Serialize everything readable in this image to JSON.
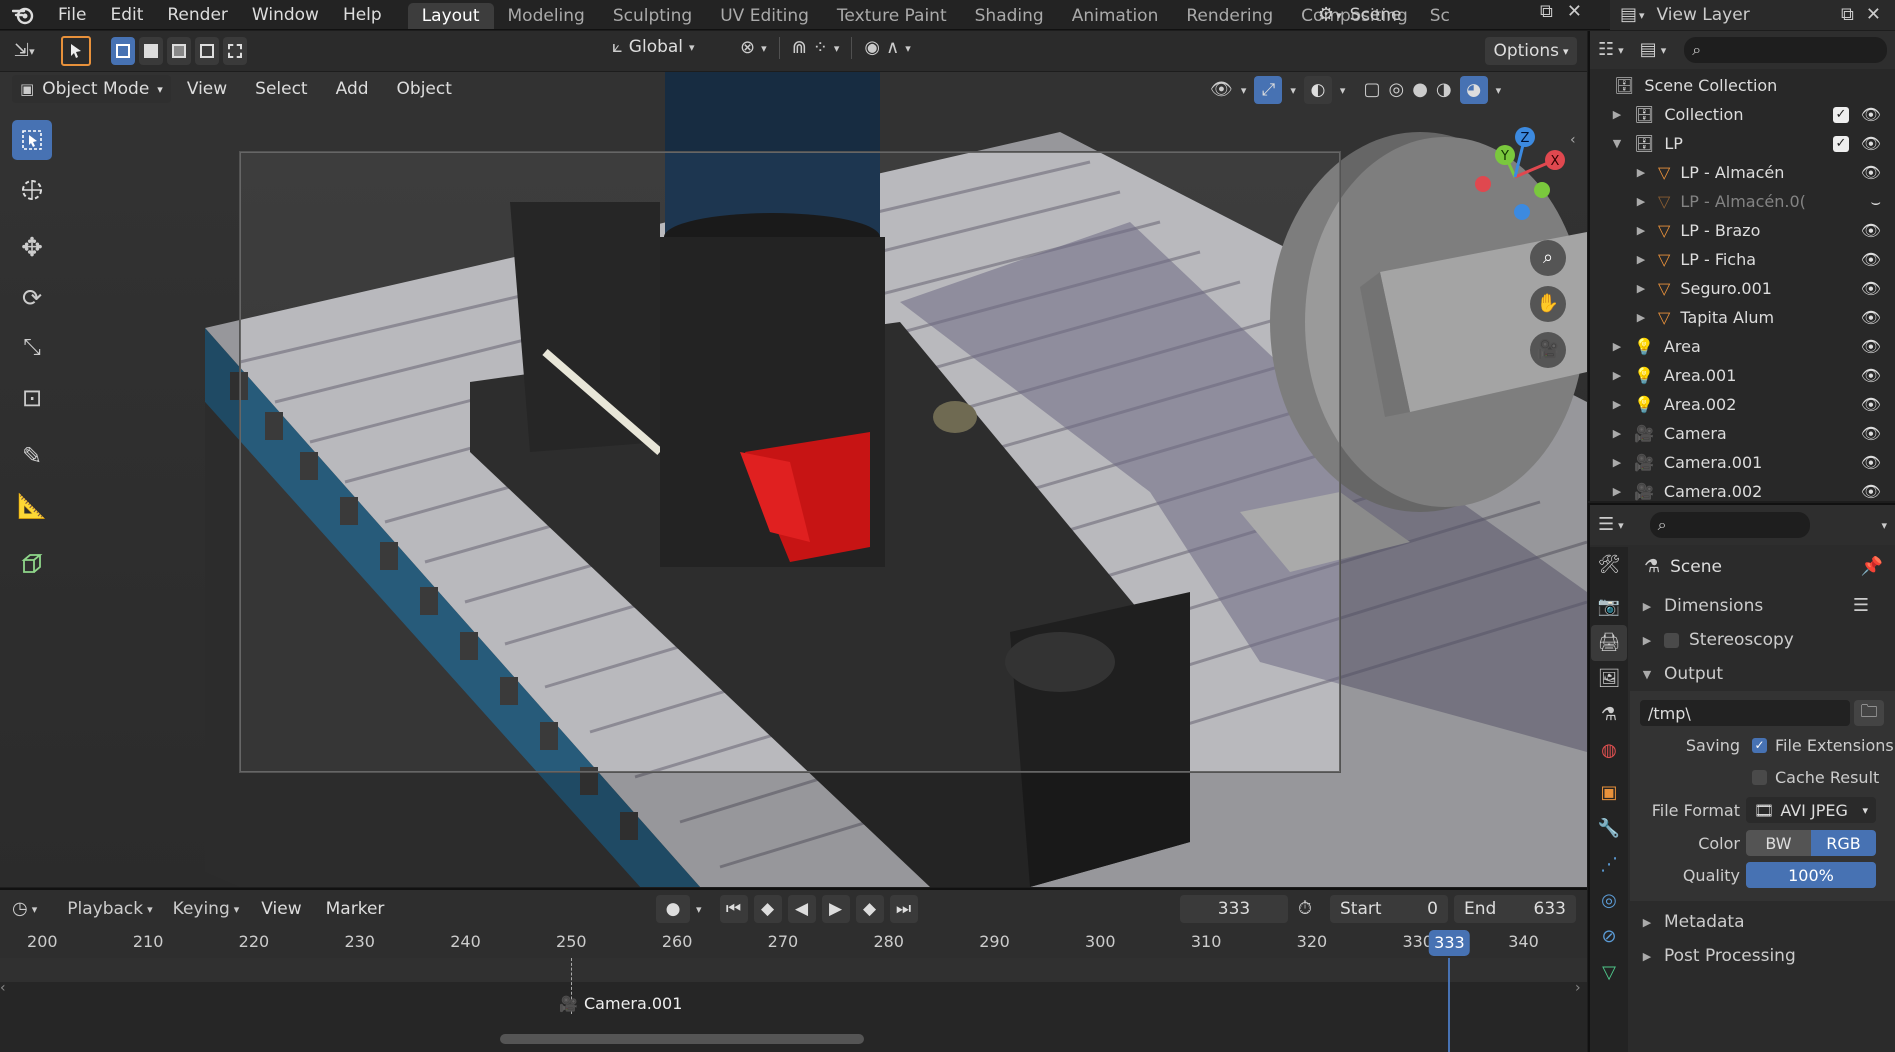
{
  "app": {
    "menus": [
      "File",
      "Edit",
      "Render",
      "Window",
      "Help"
    ],
    "workspaces": [
      "Layout",
      "Modeling",
      "Sculpting",
      "UV Editing",
      "Texture Paint",
      "Shading",
      "Animation",
      "Rendering",
      "Compositing",
      "Sc"
    ],
    "active_workspace": "Layout",
    "scene_name": "Scene",
    "view_layer": "View Layer"
  },
  "toolbar": {
    "orientation": "Global",
    "options_label": "Options"
  },
  "viewport_header": {
    "mode": "Object Mode",
    "menus": [
      "View",
      "Select",
      "Add",
      "Object"
    ]
  },
  "outliner": {
    "root": "Scene Collection",
    "items": [
      {
        "label": "Collection",
        "type": "collection",
        "indent": 0,
        "expanded": false,
        "checked": true
      },
      {
        "label": "LP",
        "type": "collection",
        "indent": 0,
        "expanded": true,
        "checked": true
      },
      {
        "label": "LP - Almacén",
        "type": "mesh",
        "indent": 1
      },
      {
        "label": "LP - Almacén.0(",
        "type": "mesh",
        "indent": 1,
        "dimmed": true
      },
      {
        "label": "LP - Brazo",
        "type": "mesh",
        "indent": 1
      },
      {
        "label": "LP - Ficha",
        "type": "mesh",
        "indent": 1
      },
      {
        "label": "Seguro.001",
        "type": "mesh",
        "indent": 1
      },
      {
        "label": "Tapita Alum",
        "type": "mesh",
        "indent": 1
      },
      {
        "label": "Area",
        "type": "light",
        "indent": 0
      },
      {
        "label": "Area.001",
        "type": "light",
        "indent": 0
      },
      {
        "label": "Area.002",
        "type": "light",
        "indent": 0
      },
      {
        "label": "Camera",
        "type": "camera",
        "indent": 0
      },
      {
        "label": "Camera.001",
        "type": "camera",
        "indent": 0
      },
      {
        "label": "Camera.002",
        "type": "camera",
        "indent": 0
      }
    ]
  },
  "properties": {
    "context": "Scene",
    "panels": {
      "dimensions": "Dimensions",
      "stereoscopy": "Stereoscopy",
      "output": "Output",
      "metadata": "Metadata",
      "post_processing": "Post Processing"
    },
    "output_path": "/tmp\\",
    "saving_label": "Saving",
    "file_extensions": "File Extensions",
    "cache_result": "Cache Result",
    "file_format_label": "File Format",
    "file_format": "AVI JPEG",
    "color_label": "Color",
    "color_bw": "BW",
    "color_rgb": "RGB",
    "quality_label": "Quality",
    "quality": "100%",
    "quality_fraction": 1.0
  },
  "timeline": {
    "menus": [
      "Playback",
      "Keying",
      "View",
      "Marker"
    ],
    "current_frame": "333",
    "start_label": "Start",
    "start": "0",
    "end_label": "End",
    "end": "633",
    "ticks": [
      "200",
      "210",
      "220",
      "230",
      "240",
      "250",
      "260",
      "270",
      "280",
      "290",
      "300",
      "310",
      "320",
      "330",
      "340"
    ],
    "tick_values": [
      200,
      210,
      220,
      230,
      240,
      250,
      260,
      270,
      280,
      290,
      300,
      310,
      320,
      330,
      340
    ],
    "visible_range": [
      196,
      346
    ],
    "playhead_frame": 333,
    "marker_label": "Camera.001",
    "marker_frame": 250
  },
  "colors": {
    "accent": "#4772b3",
    "mesh_icon": "#e8913b",
    "light_icon": "#4fc78a",
    "x_axis": "#e0484f",
    "y_axis": "#7ac83d",
    "z_axis": "#3c8ae0"
  }
}
